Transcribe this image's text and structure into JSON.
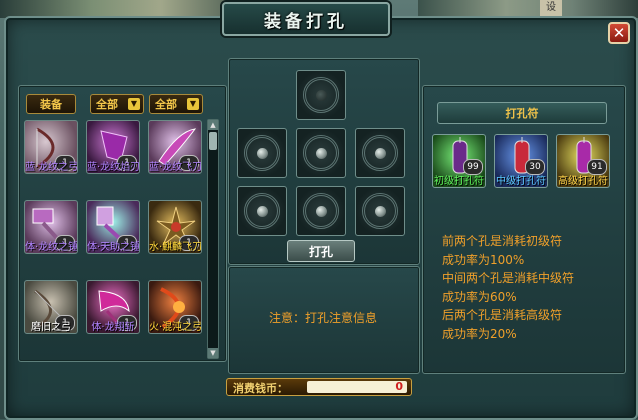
{
  "window": {
    "title": "装备打孔",
    "close_label": "✕"
  },
  "background": {
    "sign_text": "设"
  },
  "left": {
    "tab_equip": "装备",
    "filter1": "全部",
    "filter2": "全部",
    "items": [
      {
        "label": "蓝·龙纹之弓",
        "count": "1",
        "color": "purple"
      },
      {
        "label": "蓝·龙纹焰刃",
        "count": "1",
        "color": "purple"
      },
      {
        "label": "蓝·龙纹飞刀",
        "count": "1",
        "color": "purple"
      },
      {
        "label": "体·龙纹之锤",
        "count": "1",
        "color": "purple"
      },
      {
        "label": "体·天助之锤",
        "count": "1",
        "color": "purple"
      },
      {
        "label": "水·麒麟飞刀",
        "count": "1",
        "color": "yellow"
      },
      {
        "label": "磨旧之弓",
        "count": "1",
        "color": "white"
      },
      {
        "label": "体·龙翔斩",
        "count": "1",
        "color": "purple"
      },
      {
        "label": "火·混沌之弓",
        "count": "1",
        "color": "yellow"
      }
    ]
  },
  "middle": {
    "punch_button": "打孔",
    "notice": "注意：打孔注意信息"
  },
  "right": {
    "header": "打孔符",
    "runes": [
      {
        "label": "初级打孔符",
        "count": "99",
        "color": "green"
      },
      {
        "label": "中级打孔符",
        "count": "30",
        "color": "cyan"
      },
      {
        "label": "高级打孔符",
        "count": "91",
        "color": "gold"
      }
    ],
    "info": [
      "前两个孔是消耗初级符",
      "成功率为100%",
      "中间两个孔是消耗中级符",
      "成功率为60%",
      "后两个孔是消耗高级符",
      "成功率为20%"
    ]
  },
  "cost": {
    "label": "消费钱币：",
    "value": "0"
  }
}
